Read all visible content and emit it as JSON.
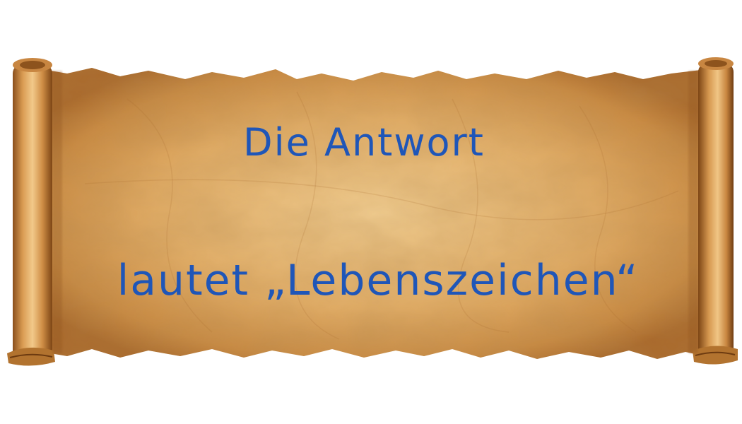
{
  "scroll": {
    "line1": "Die Antwort",
    "line2": "lautet „Lebenszeichen“"
  },
  "colors": {
    "text": "#1f56b8",
    "parchment_light": "#f0c88a",
    "parchment_dark": "#b86f2a",
    "background": "#ffffff"
  }
}
